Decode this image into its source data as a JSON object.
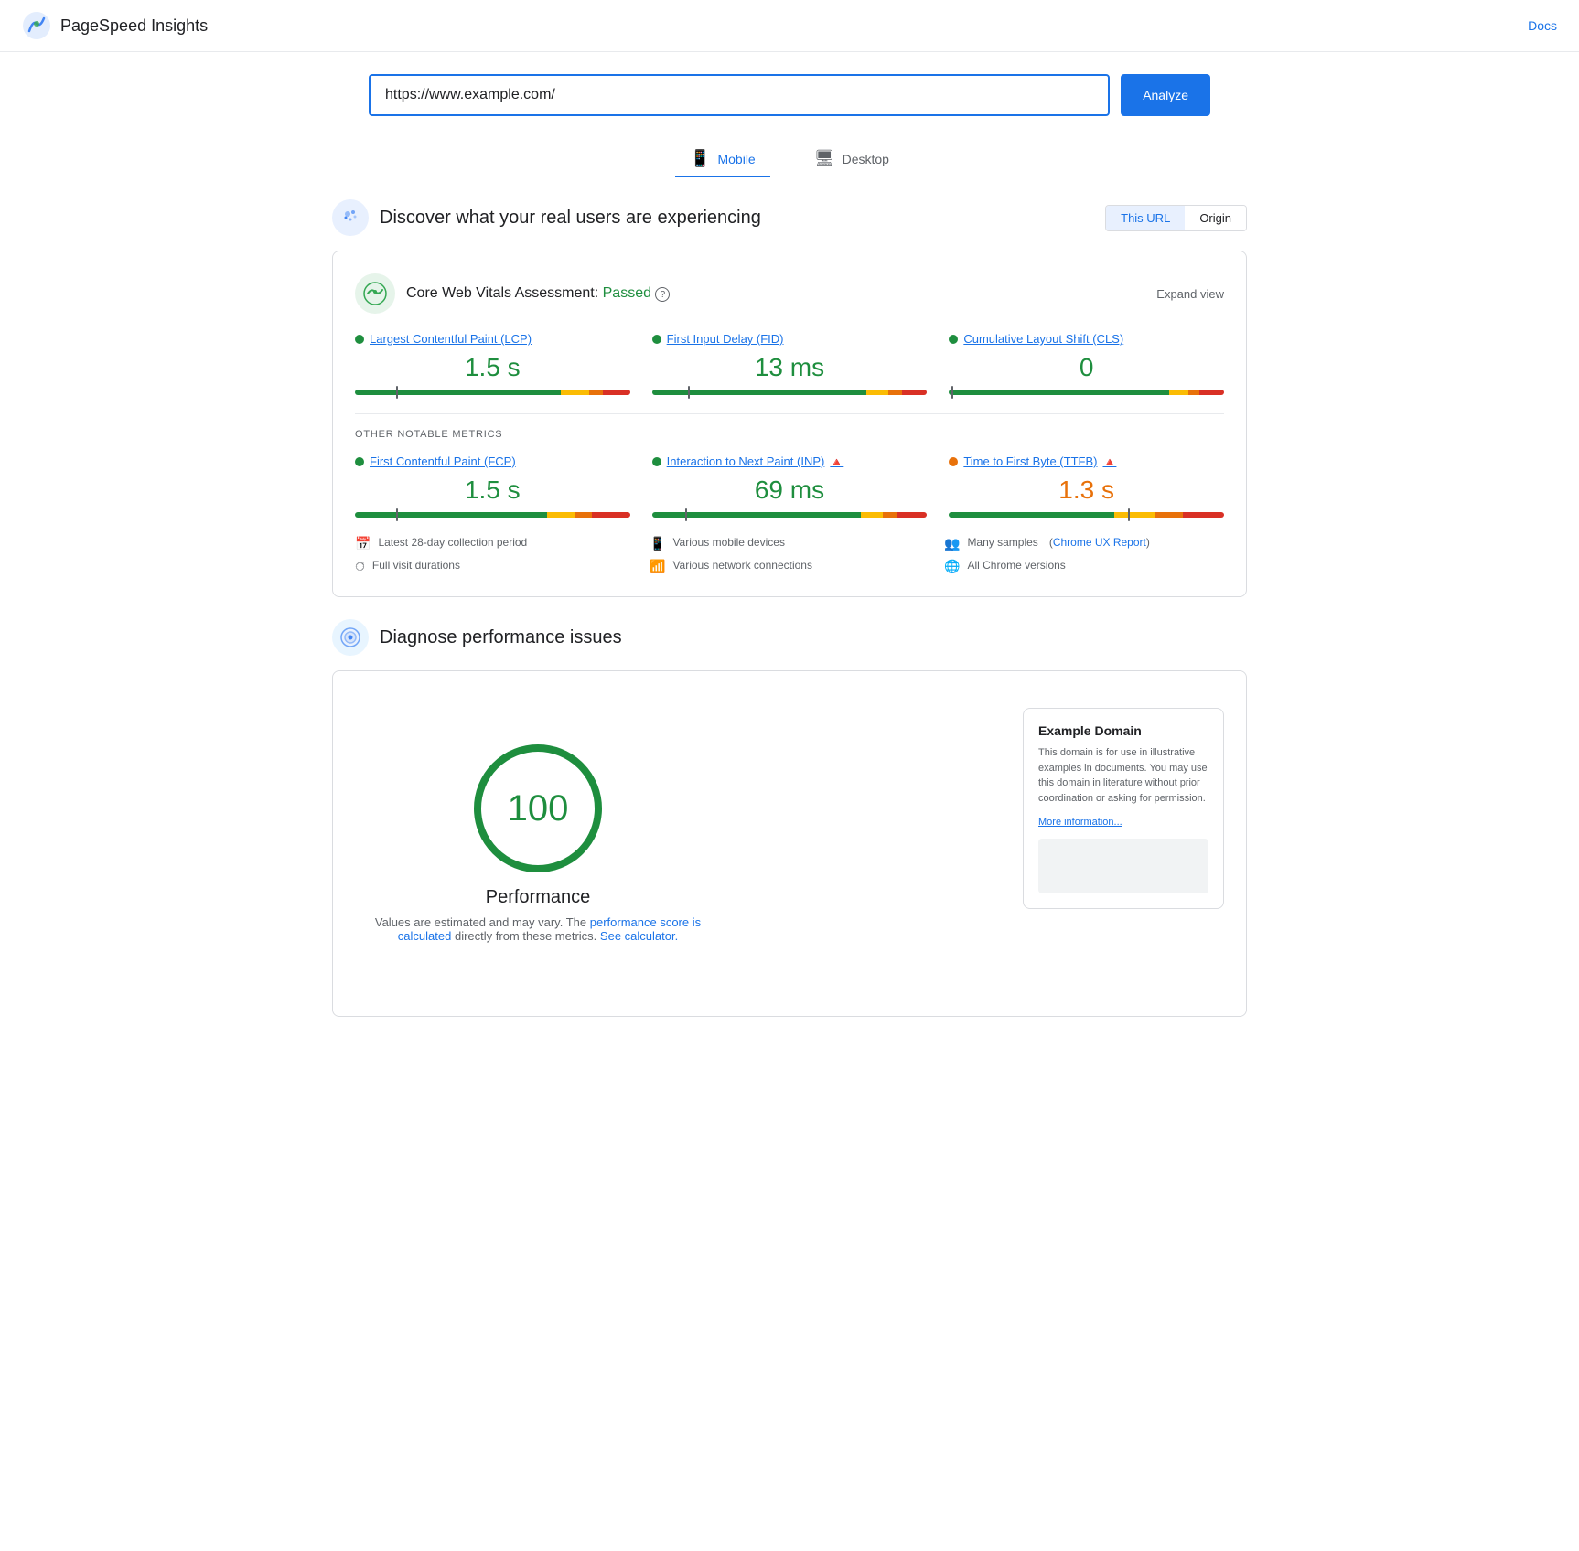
{
  "header": {
    "title": "PageSpeed Insights",
    "docs_label": "Docs"
  },
  "search": {
    "url_value": "https://www.example.com/",
    "url_placeholder": "Enter a web page URL",
    "analyze_label": "Analyze"
  },
  "tabs": [
    {
      "id": "mobile",
      "label": "Mobile",
      "icon": "📱",
      "active": true
    },
    {
      "id": "desktop",
      "label": "Desktop",
      "icon": "🖥",
      "active": false
    }
  ],
  "real_users": {
    "section_title": "Discover what your real users are experiencing",
    "toggle": {
      "this_url_label": "This URL",
      "origin_label": "Origin"
    },
    "cwv": {
      "title": "Core Web Vitals Assessment:",
      "status": "Passed",
      "expand_label": "Expand view",
      "tooltip": "?"
    },
    "metrics": [
      {
        "id": "lcp",
        "dot_color": "green",
        "label": "Largest Contentful Paint (LCP)",
        "value": "1.5 s",
        "value_color": "green",
        "bar": {
          "green": 75,
          "yellow": 10,
          "orange": 5,
          "red": 10,
          "indicator_pct": 15
        }
      },
      {
        "id": "fid",
        "dot_color": "green",
        "label": "First Input Delay (FID)",
        "value": "13 ms",
        "value_color": "green",
        "bar": {
          "green": 78,
          "yellow": 8,
          "orange": 5,
          "red": 9,
          "indicator_pct": 13
        }
      },
      {
        "id": "cls",
        "dot_color": "green",
        "label": "Cumulative Layout Shift (CLS)",
        "value": "0",
        "value_color": "green",
        "bar": {
          "green": 80,
          "yellow": 7,
          "orange": 4,
          "red": 9,
          "indicator_pct": 1
        }
      }
    ],
    "notable_metrics_label": "OTHER NOTABLE METRICS",
    "notable_metrics": [
      {
        "id": "fcp",
        "dot_color": "green",
        "label": "First Contentful Paint (FCP)",
        "value": "1.5 s",
        "value_color": "green",
        "has_warning": false,
        "bar": {
          "green": 70,
          "yellow": 10,
          "orange": 6,
          "red": 14,
          "indicator_pct": 15
        }
      },
      {
        "id": "inp",
        "dot_color": "green",
        "label": "Interaction to Next Paint (INP)",
        "value": "69 ms",
        "value_color": "green",
        "has_warning": true,
        "bar": {
          "green": 76,
          "yellow": 8,
          "orange": 5,
          "red": 11,
          "indicator_pct": 12
        }
      },
      {
        "id": "ttfb",
        "dot_color": "orange",
        "label": "Time to First Byte (TTFB)",
        "value": "1.3 s",
        "value_color": "orange",
        "has_warning": true,
        "bar": {
          "green": 60,
          "yellow": 15,
          "orange": 10,
          "red": 15,
          "indicator_pct": 65
        }
      }
    ],
    "info_items": [
      {
        "icon": "📅",
        "text": "Latest 28-day collection period"
      },
      {
        "icon": "📱",
        "text": "Various mobile devices"
      },
      {
        "icon": "👥",
        "text": "Many samples"
      },
      {
        "icon": "⏱",
        "text": "Full visit durations"
      },
      {
        "icon": "📶",
        "text": "Various network connections"
      },
      {
        "icon": "🌐",
        "text": "All Chrome versions"
      }
    ],
    "chrome_ux_label": "Chrome UX Report"
  },
  "diagnose": {
    "section_title": "Diagnose performance issues",
    "score": {
      "value": "100",
      "label": "Performance",
      "desc_prefix": "Values are estimated and may vary. The",
      "desc_link_text": "performance score is calculated",
      "desc_mid": "directly from these metrics.",
      "calc_link_text": "See calculator."
    },
    "preview": {
      "title": "Example Domain",
      "text": "This domain is for use in illustrative examples in documents. You may use this domain in literature without prior coordination or asking for permission.",
      "more_link": "More information..."
    }
  }
}
